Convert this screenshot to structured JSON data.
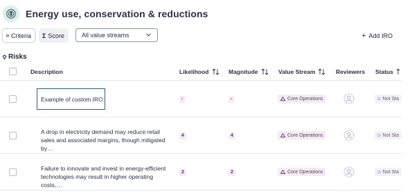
{
  "header": {
    "title": "Energy use, conservation & reductions",
    "icon": "target-leaf-icon"
  },
  "toolbar": {
    "criteria_label": "Criteria",
    "score_label": "Score",
    "filter_value": "All value streams",
    "add_label": "Add IRO"
  },
  "section": {
    "title": "Risks"
  },
  "table": {
    "columns": {
      "description": "Description",
      "likelihood": "Likelihood",
      "magnitude": "Magnitude",
      "value_stream": "Value Stream",
      "reviewers": "Reviewers",
      "status": "Status"
    },
    "rows": [
      {
        "description": "Example of custom IRO",
        "likelihood": "-",
        "magnitude": "-",
        "value_stream": "Core Operations",
        "status": "Not Sta"
      },
      {
        "description": "A drop in electricity demand may reduce retail sales and associated margins, though mitigated by…",
        "likelihood": "4",
        "magnitude": "4",
        "value_stream": "Core Operations",
        "status": "Not Sta"
      },
      {
        "description": "Failure to innovate and invest in energy-efficient technologies may result in higher operating costs,…",
        "likelihood": "2",
        "magnitude": "2",
        "value_stream": "Core Operations",
        "status": "Not Sta"
      }
    ]
  },
  "colors": {
    "accent": "#2c5d6e",
    "pill_bg": "#f3ecf3",
    "pill_text": "#5a3d5c",
    "icon_bg": "#dbeeea"
  }
}
